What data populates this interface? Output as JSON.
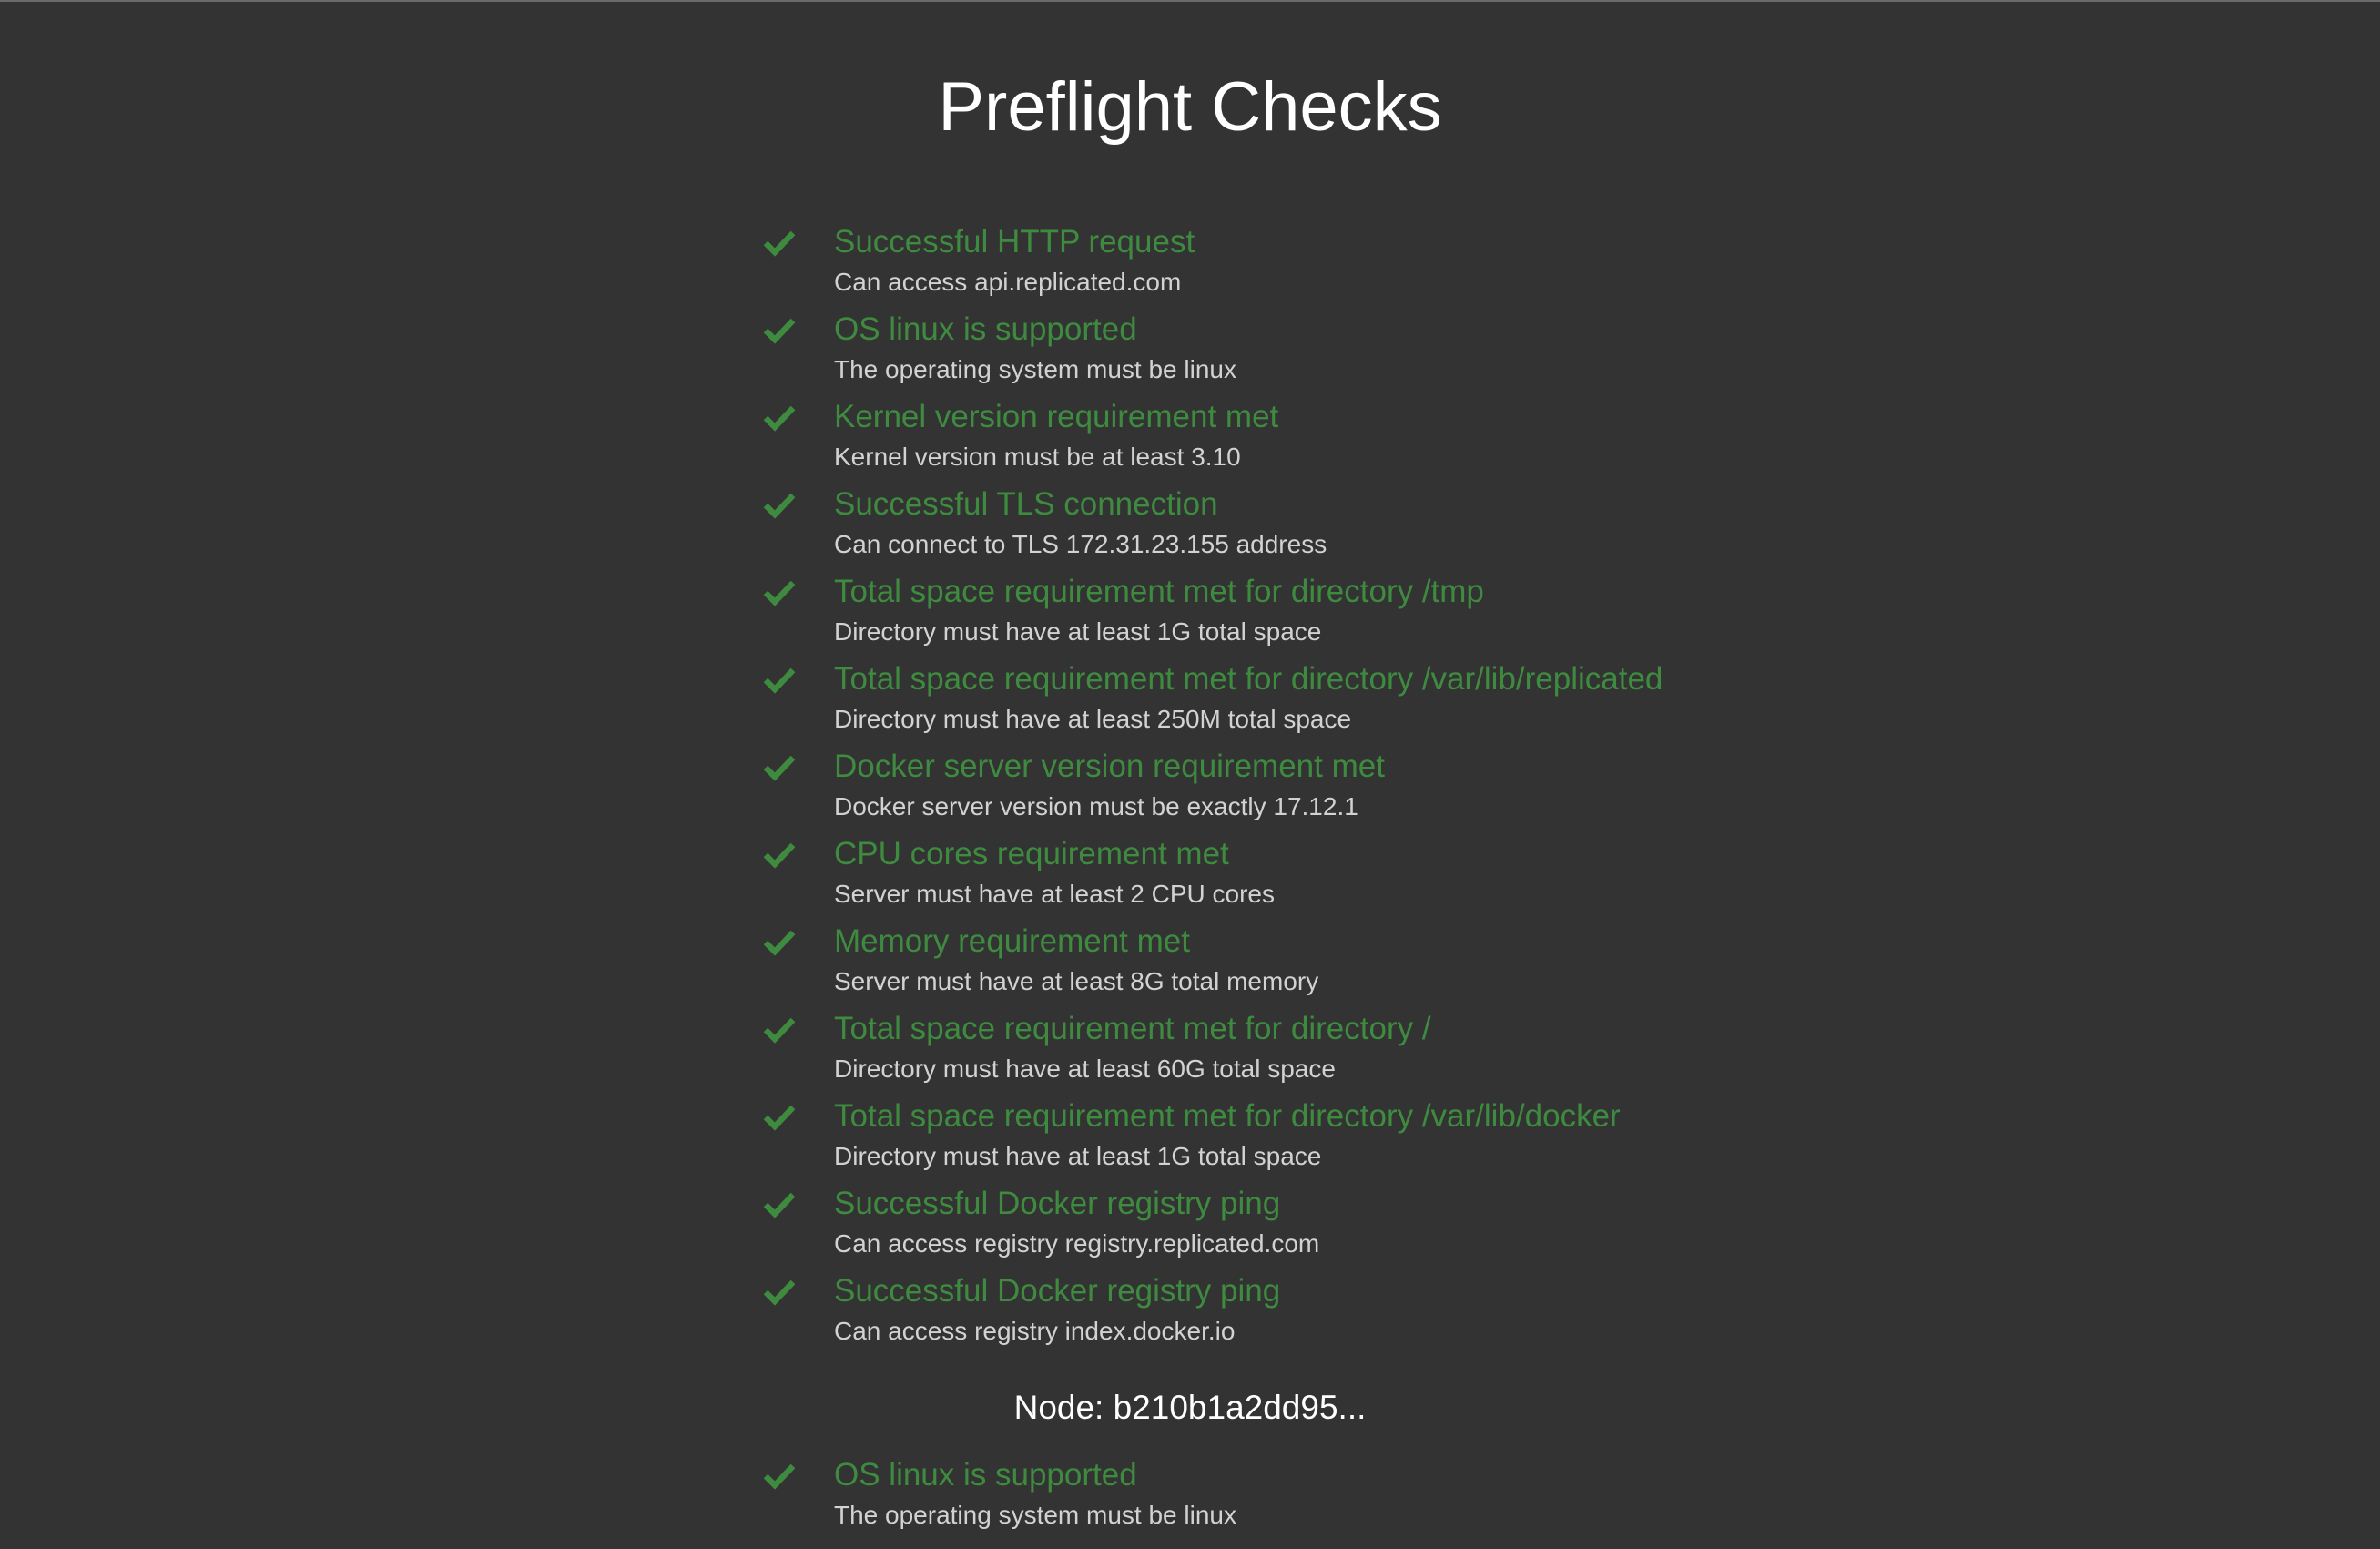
{
  "page": {
    "title": "Preflight Checks"
  },
  "colors": {
    "background": "#333333",
    "pass_green": "#3e8b40",
    "description": "#d2d2d2",
    "heading": "#ffffff"
  },
  "checks": [
    {
      "icon": "check-icon",
      "title": "Successful HTTP request",
      "description": "Can access api.replicated.com"
    },
    {
      "icon": "check-icon",
      "title": "OS linux is supported",
      "description": "The operating system must be linux"
    },
    {
      "icon": "check-icon",
      "title": "Kernel version requirement met",
      "description": "Kernel version must be at least 3.10"
    },
    {
      "icon": "check-icon",
      "title": "Successful TLS connection",
      "description": "Can connect to TLS 172.31.23.155 address"
    },
    {
      "icon": "check-icon",
      "title": "Total space requirement met for directory /tmp",
      "description": "Directory must have at least 1G total space"
    },
    {
      "icon": "check-icon",
      "title": "Total space requirement met for directory /var/lib/replicated",
      "description": "Directory must have at least 250M total space"
    },
    {
      "icon": "check-icon",
      "title": "Docker server version requirement met",
      "description": "Docker server version must be exactly 17.12.1"
    },
    {
      "icon": "check-icon",
      "title": "CPU cores requirement met",
      "description": "Server must have at least 2 CPU cores"
    },
    {
      "icon": "check-icon",
      "title": "Memory requirement met",
      "description": "Server must have at least 8G total memory"
    },
    {
      "icon": "check-icon",
      "title": "Total space requirement met for directory /",
      "description": "Directory must have at least 60G total space"
    },
    {
      "icon": "check-icon",
      "title": "Total space requirement met for directory /var/lib/docker",
      "description": "Directory must have at least 1G total space"
    },
    {
      "icon": "check-icon",
      "title": "Successful Docker registry ping",
      "description": "Can access registry registry.replicated.com"
    },
    {
      "icon": "check-icon",
      "title": "Successful Docker registry ping",
      "description": "Can access registry index.docker.io"
    }
  ],
  "node": {
    "heading": "Node: b210b1a2dd95...",
    "checks": [
      {
        "icon": "check-icon",
        "title": "OS linux is supported",
        "description": "The operating system must be linux"
      }
    ]
  }
}
